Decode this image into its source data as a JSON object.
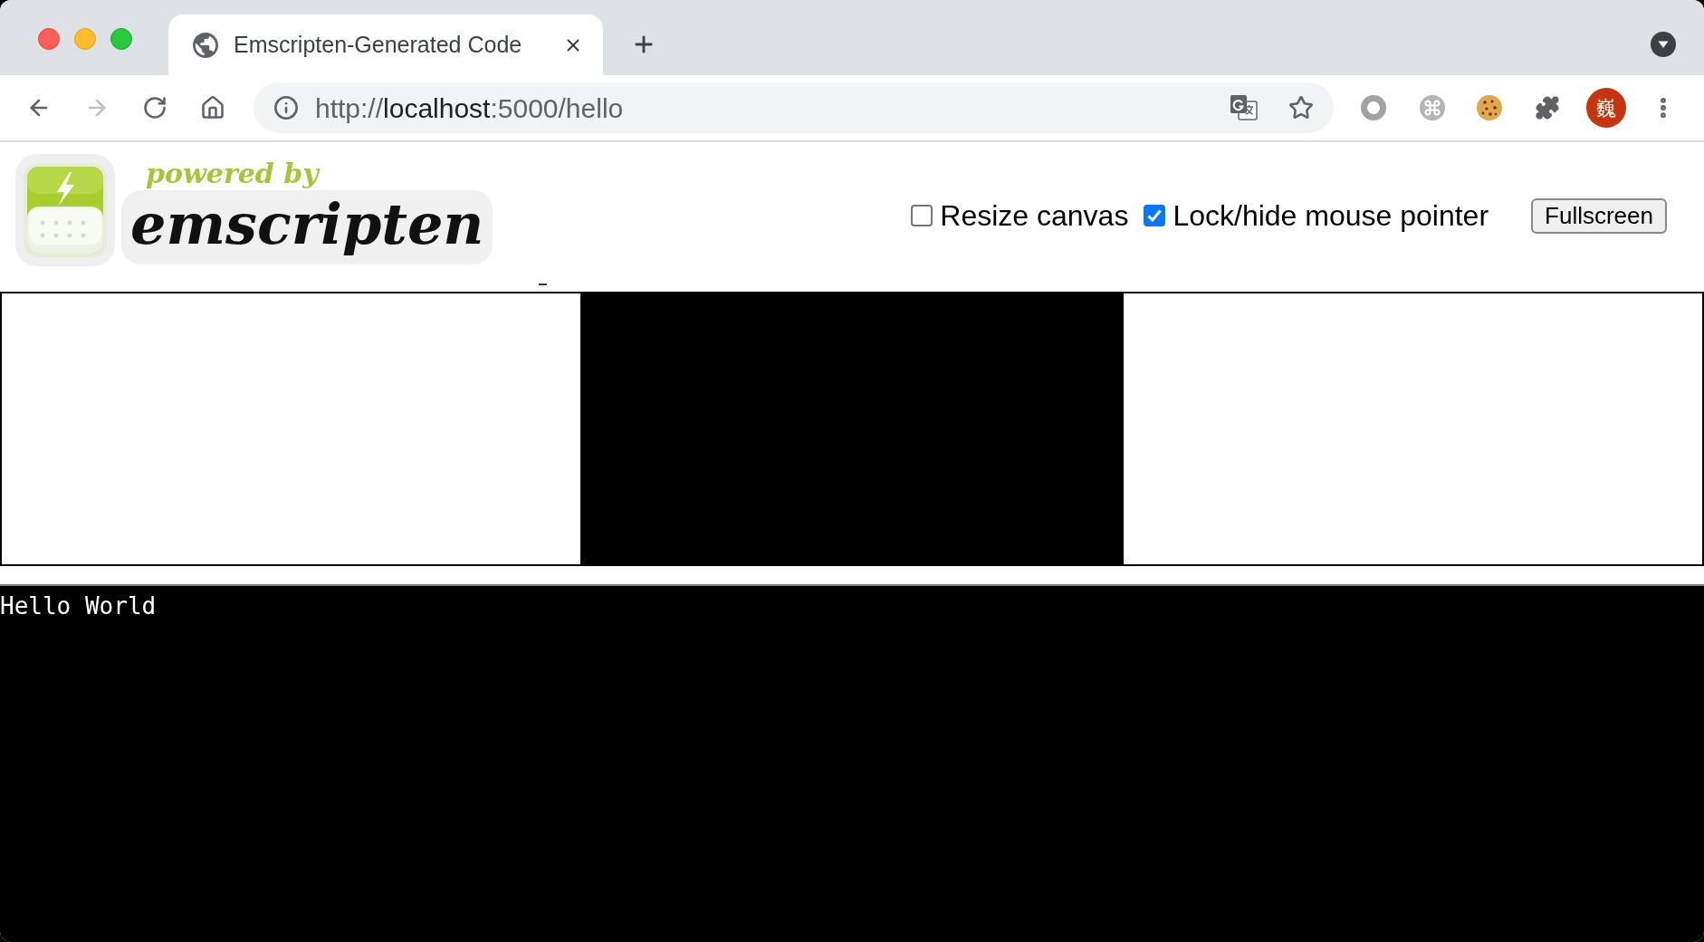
{
  "browser": {
    "tabs": [
      {
        "title": "Emscripten-Generated Code",
        "selected": true
      }
    ],
    "nav_buttons": [
      {
        "kind": "back",
        "disabled": false
      },
      {
        "kind": "forward",
        "disabled": true
      },
      {
        "kind": "reload",
        "disabled": false
      },
      {
        "kind": "home",
        "disabled": false
      }
    ],
    "address_bar": {
      "scheme": "http://",
      "host": "localhost",
      "path": ":5000/hello"
    },
    "profile": {
      "initial": "巍"
    }
  },
  "page": {
    "logo": {
      "tagline": "powered by",
      "wordmark": "emscripten"
    },
    "controls": [
      {
        "kind": "checkbox",
        "label": "Resize canvas",
        "checked": false
      },
      {
        "kind": "checkbox",
        "label": "Lock/hide mouse pointer",
        "checked": true
      },
      {
        "kind": "button",
        "label": "Fullscreen"
      }
    ],
    "console": {
      "lines": [
        "Hello World"
      ]
    }
  }
}
